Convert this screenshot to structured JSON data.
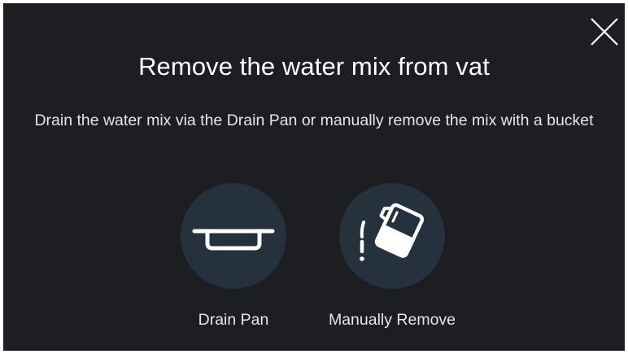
{
  "dialog": {
    "title": "Remove the water mix from vat",
    "description": "Drain the water mix via the Drain Pan or manually remove the mix with a bucket"
  },
  "options": [
    {
      "label": "Drain Pan",
      "icon": "drain-pan-icon"
    },
    {
      "label": "Manually Remove",
      "icon": "pouring-container-icon"
    }
  ],
  "colors": {
    "background": "#1c1e22",
    "circle": "#25313d",
    "text": "#ffffff"
  }
}
